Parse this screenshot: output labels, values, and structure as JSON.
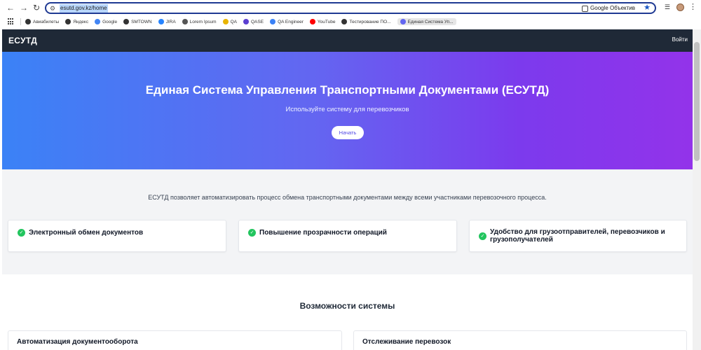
{
  "browser": {
    "url": "esutd.gov.kz/home",
    "lens_label": "Google Объектив",
    "bookmarks": [
      {
        "label": "Авиабилеты",
        "color": "#333333"
      },
      {
        "label": "Яндекс",
        "color": "#333333"
      },
      {
        "label": "Google",
        "color": "#4285f4"
      },
      {
        "label": "SMTOWN",
        "color": "#333333"
      },
      {
        "label": "JIRA",
        "color": "#2684ff"
      },
      {
        "label": "Lorem Ipsum",
        "color": "#555555"
      },
      {
        "label": "QA",
        "color": "#e8b400"
      },
      {
        "label": "QASE",
        "color": "#5b3fd1"
      },
      {
        "label": "QA Engineer",
        "color": "#3b82f6"
      },
      {
        "label": "YouTube",
        "color": "#ff0000"
      },
      {
        "label": "Тестирование ПО...",
        "color": "#333333"
      },
      {
        "label": "Единая Система Уп...",
        "color": "#6366f1"
      }
    ]
  },
  "navbar": {
    "logo": "ЕСУТД",
    "login": "Войти"
  },
  "hero": {
    "title": "Единая Система Управления Транспортными Документами (ЕСУТД)",
    "subtitle": "Используйте систему для перевозчиков",
    "cta": "Начать"
  },
  "benefits": {
    "description": "ЕСУТД позволяет автоматизировать процесс обмена транспортными документами между всеми участниками перевозочного процесса.",
    "cards": [
      {
        "text": "Электронный обмен документов"
      },
      {
        "text": "Повышение прозрачности операций"
      },
      {
        "line1": "Удобство для грузоотправителей, перевозчиков и",
        "line2": "грузополучателей"
      }
    ]
  },
  "features": {
    "title": "Возможности системы",
    "cards": [
      {
        "text": "Автоматизация документооборота"
      },
      {
        "text": "Отслеживание перевозок"
      }
    ]
  },
  "colors": {
    "navbar": "#1f2937",
    "hero_gradient_start": "#3b82f6",
    "hero_gradient_end": "#9333ea",
    "check": "#22c55e"
  }
}
